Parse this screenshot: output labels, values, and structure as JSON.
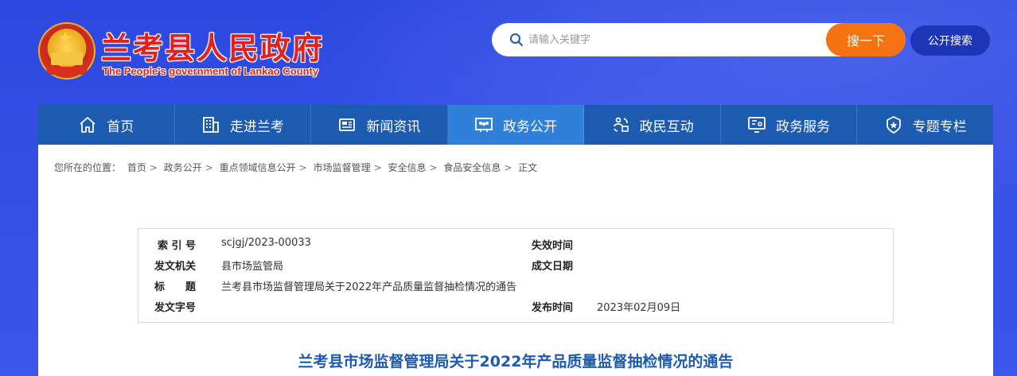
{
  "header": {
    "title": "兰考县人民政府",
    "subtitle": "The People's government of Lankao County",
    "search": {
      "placeholder": "请输入关键字",
      "button_label": "搜一下",
      "public_search_label": "公开搜索"
    }
  },
  "nav": {
    "items": [
      {
        "label": "首页",
        "icon": "home-icon"
      },
      {
        "label": "走进兰考",
        "icon": "building-icon"
      },
      {
        "label": "新闻资讯",
        "icon": "newspaper-icon"
      },
      {
        "label": "政务公开",
        "icon": "people-board-icon",
        "active": true
      },
      {
        "label": "政民互动",
        "icon": "interaction-icon"
      },
      {
        "label": "政务服务",
        "icon": "service-monitor-icon"
      },
      {
        "label": "专题专栏",
        "icon": "badge-star-icon"
      }
    ]
  },
  "breadcrumb": {
    "prefix": "您所在的位置：",
    "items": [
      "首页",
      "政务公开",
      "重点领域信息公开",
      "市场监督管理",
      "安全信息",
      "食品安全信息",
      "正文"
    ]
  },
  "info": {
    "index_label": "索 引 号",
    "index_value": "scjgj/2023-00033",
    "expire_label": "失效时间",
    "expire_value": "",
    "issuer_label": "发文机关",
    "issuer_value": "县市场监管局",
    "created_label": "成文日期",
    "created_value": "",
    "subject_label": "标　　题",
    "subject_value": "兰考县市场监督管理局关于2022年产品质量监督抽检情况的通告",
    "docno_label": "发文字号",
    "docno_value": "",
    "publish_label": "发布时间",
    "publish_value": "2023年02月09日"
  },
  "article": {
    "title": "兰考县市场监督管理局关于2022年产品质量监督抽检情况的通告"
  },
  "colors": {
    "background": "#2f4de0",
    "nav": "#1c5bb0",
    "nav_active": "#2f80d8",
    "title_red": "#e3201b",
    "search_button": "#f4720f",
    "article_title": "#1c5bb0"
  }
}
